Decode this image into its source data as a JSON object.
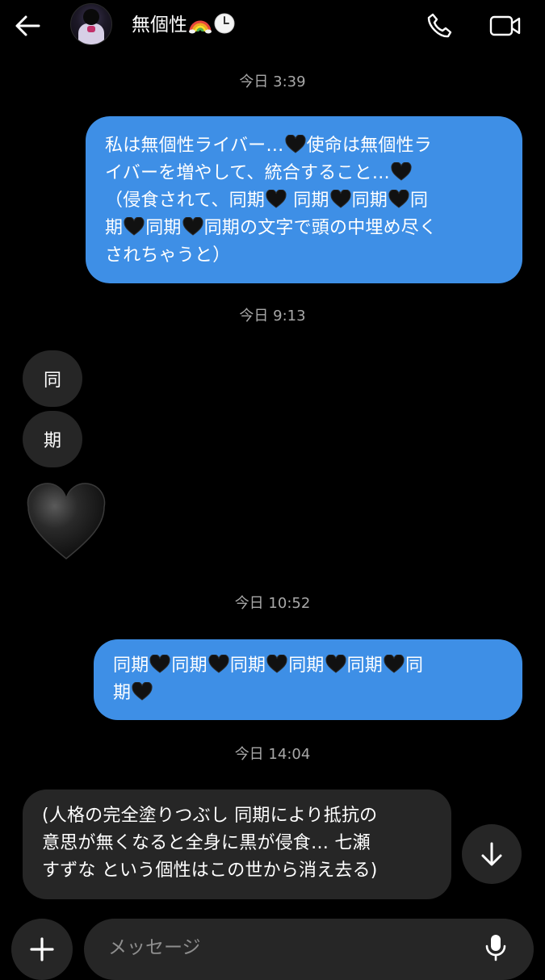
{
  "header": {
    "contact_name": "無個性",
    "back_icon": "arrow-left-icon",
    "call_icon": "phone-icon",
    "video_icon": "video-camera-icon",
    "name_emojis": [
      "rainbow-emoji",
      "clock-emoji"
    ]
  },
  "messages": [
    {
      "type": "timestamp",
      "text": "今日 3:39"
    },
    {
      "type": "sent",
      "lines": [
        [
          "私は無個性ライバー…",
          "♥",
          "使命は無個性ラ"
        ],
        [
          "イバーを増やして、統合すること…",
          "♥"
        ],
        [
          "（侵食されて、同期",
          "♥",
          " 同期",
          "♥",
          "同期",
          "♥",
          "同"
        ],
        [
          "期",
          "♥",
          "同期",
          "♥",
          "同期の文字で頭の中埋め尽く"
        ],
        [
          "されちゃうと）"
        ]
      ]
    },
    {
      "type": "timestamp",
      "text": "今日 9:13"
    },
    {
      "type": "received_char",
      "text": "同"
    },
    {
      "type": "received_char",
      "text": "期"
    },
    {
      "type": "received_emoji",
      "emoji": "black-heart-emoji"
    },
    {
      "type": "timestamp",
      "text": "今日 10:52"
    },
    {
      "type": "sent",
      "lines": [
        [
          "同期",
          "♥",
          "同期",
          "♥",
          "同期",
          "♥",
          "同期",
          "♥",
          "同期",
          "♥",
          "同期"
        ],
        [
          "期",
          "♥"
        ]
      ]
    },
    {
      "type": "timestamp",
      "text": "今日 14:04"
    },
    {
      "type": "received",
      "lines": [
        "(人格の完全塗りつぶし 同期により抵抗の",
        "意思が無くなると全身に黒が侵食… 七瀬",
        "すずな という個性はこの世から消え去る)"
      ]
    }
  ],
  "ts": {
    "t1": "今日 3:39",
    "t2": "今日 9:13",
    "t3": "今日 10:52",
    "t4": "今日 14:04"
  },
  "bubble1": {
    "l1a": "私は無個性ライバー…",
    "l1b": "使命は無個性ラ",
    "l2a": "イバーを増やして、統合すること…",
    "l3a": "（侵食されて、同期",
    "l3b": " 同期",
    "l3c": "同期",
    "l3d": "同",
    "l4a": "期",
    "l4b": "同期",
    "l4c": "同期の文字で頭の中埋め尽く",
    "l5a": "されちゃうと）"
  },
  "char1": "同",
  "char2": "期",
  "bubble2": {
    "w": "同期",
    "last": "同",
    "l2": "期"
  },
  "bubble3": {
    "l1": "(人格の完全塗りつぶし 同期により抵抗の",
    "l2": "意思が無くなると全身に黒が侵食… 七瀬",
    "l3": "すずな という個性はこの世から消え去る)"
  },
  "composer": {
    "placeholder": "メッセージ",
    "add_icon": "plus-icon",
    "mic_icon": "microphone-icon"
  },
  "scroll_icon": "arrow-down-icon",
  "colors": {
    "background": "#000000",
    "sent_bubble": "#3e8fe6",
    "received_bubble": "#262626",
    "timestamp_text": "#a8a8a8"
  }
}
